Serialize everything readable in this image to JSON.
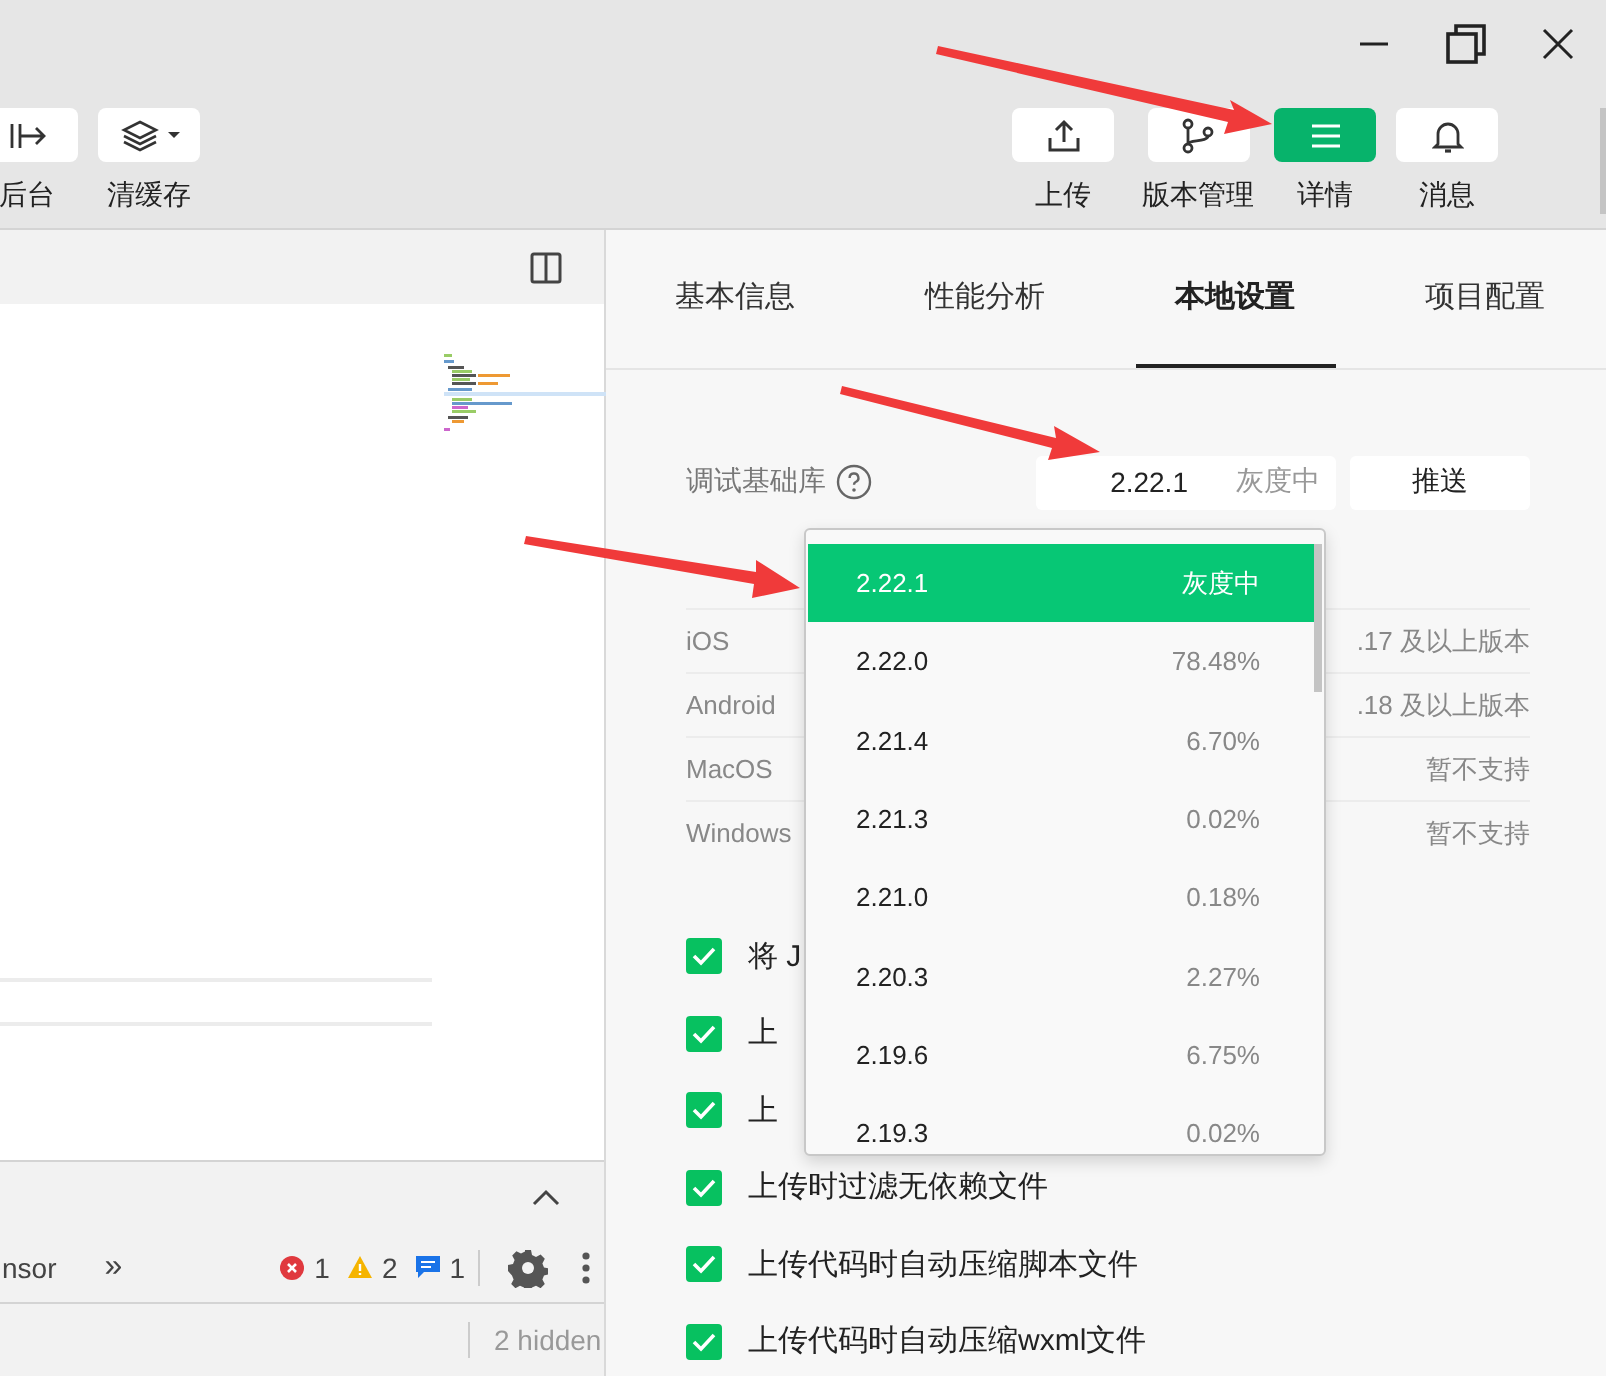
{
  "toolbar": {
    "left_buttons": [
      {
        "label": "后台",
        "kind": "backend"
      },
      {
        "label": "清缓存",
        "kind": "layers"
      }
    ],
    "right_buttons": [
      {
        "label": "上传",
        "kind": "upload",
        "selected": false
      },
      {
        "label": "版本管理",
        "kind": "branch",
        "selected": false
      },
      {
        "label": "详情",
        "kind": "menu",
        "selected": true
      },
      {
        "label": "消息",
        "kind": "bell",
        "selected": false
      }
    ]
  },
  "devtools": {
    "tab": "nsor",
    "more": "»",
    "errors": "1",
    "warnings": "2",
    "messages": "1",
    "hidden": "2 hidden"
  },
  "details": {
    "tabs": [
      {
        "label": "基本信息",
        "selected": false
      },
      {
        "label": "性能分析",
        "selected": false
      },
      {
        "label": "本地设置",
        "selected": true
      },
      {
        "label": "项目配置",
        "selected": false
      }
    ],
    "base_lib": {
      "label": "调试基础库",
      "value": "2.22.1",
      "status": "灰度中",
      "push_button": "推送"
    },
    "platforms": [
      {
        "name": "iOS",
        "support": ".17 及以上版本"
      },
      {
        "name": "Android",
        "support": ".18 及以上版本"
      },
      {
        "name": "MacOS",
        "support": "暂不支持"
      },
      {
        "name": "Windows",
        "support": "暂不支持"
      }
    ],
    "options": [
      {
        "label": "将 J",
        "checked": true
      },
      {
        "label": "上",
        "checked": true
      },
      {
        "label": "上",
        "checked": true
      },
      {
        "label": "上传时过滤无依赖文件",
        "checked": true
      },
      {
        "label": "上传代码时自动压缩脚本文件",
        "checked": true
      },
      {
        "label": "上传代码时自动压缩wxml文件",
        "checked": true
      }
    ]
  },
  "dropdown": {
    "items": [
      {
        "version": "2.22.1",
        "share": "灰度中",
        "selected": true
      },
      {
        "version": "2.22.0",
        "share": "78.48%",
        "selected": false
      },
      {
        "version": "2.21.4",
        "share": "6.70%",
        "selected": false
      },
      {
        "version": "2.21.3",
        "share": "0.02%",
        "selected": false
      },
      {
        "version": "2.21.0",
        "share": "0.18%",
        "selected": false
      },
      {
        "version": "2.20.3",
        "share": "2.27%",
        "selected": false
      },
      {
        "version": "2.19.6",
        "share": "6.75%",
        "selected": false
      },
      {
        "version": "2.19.3",
        "share": "0.02%",
        "selected": false
      }
    ]
  }
}
